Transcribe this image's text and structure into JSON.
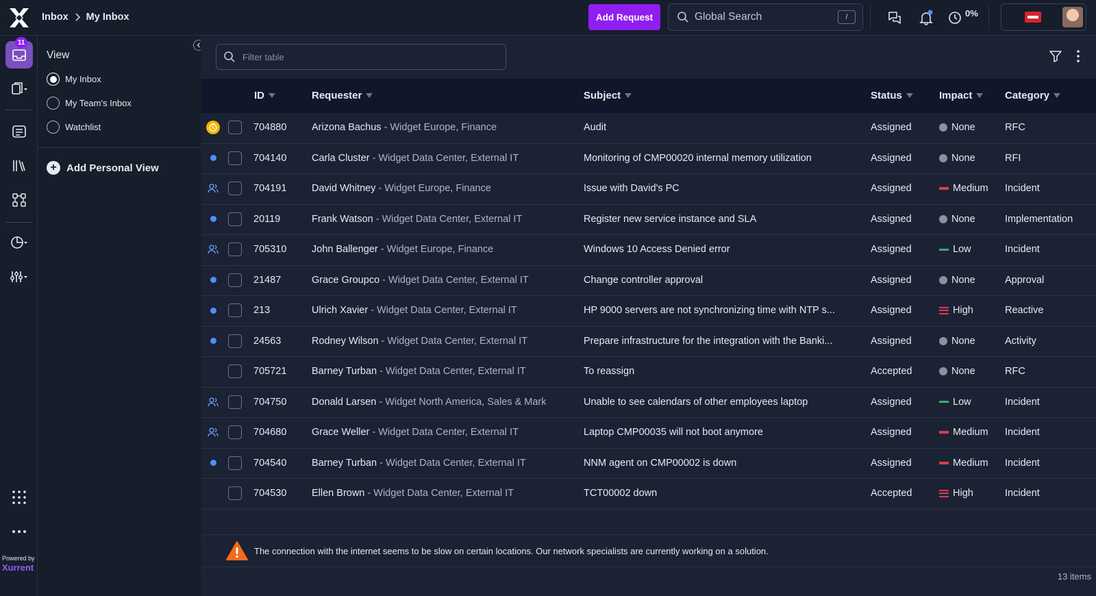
{
  "breadcrumb": {
    "root": "Inbox",
    "current": "My Inbox"
  },
  "topbar": {
    "add_request": "Add Request",
    "search_placeholder": "Global Search",
    "search_shortcut": "/",
    "percent": "0%"
  },
  "rail": {
    "inbox_badge": "11",
    "powered_by": "Powered by",
    "brand": "Xurrent"
  },
  "views": {
    "title": "View",
    "options": [
      {
        "label": "My Inbox",
        "selected": true
      },
      {
        "label": "My Team's Inbox",
        "selected": false
      },
      {
        "label": "Watchlist",
        "selected": false
      }
    ],
    "add_label": "Add Personal View"
  },
  "filter": {
    "placeholder": "Filter table"
  },
  "table": {
    "columns": {
      "id": "ID",
      "requester": "Requester",
      "subject": "Subject",
      "status": "Status",
      "impact": "Impact",
      "category": "Category"
    },
    "rows": [
      {
        "indicator": "clock",
        "id": "704880",
        "name": "Arizona Bachus",
        "org": " - Widget Europe, Finance",
        "subject": "Audit",
        "status": "Assigned",
        "impact": "None",
        "impact_level": "none",
        "category": "RFC"
      },
      {
        "indicator": "dot",
        "id": "704140",
        "name": "Carla Cluster",
        "org": " - Widget Data Center, External IT",
        "subject": "Monitoring of CMP00020 internal memory utilization",
        "status": "Assigned",
        "impact": "None",
        "impact_level": "none",
        "category": "RFI"
      },
      {
        "indicator": "team",
        "id": "704191",
        "name": "David Whitney",
        "org": " - Widget Europe, Finance",
        "subject": "Issue with David's PC",
        "status": "Assigned",
        "impact": "Medium",
        "impact_level": "medium",
        "category": "Incident"
      },
      {
        "indicator": "dot",
        "id": "20119",
        "name": "Frank Watson",
        "org": " - Widget Data Center, External IT",
        "subject": "Register new service instance and SLA",
        "status": "Assigned",
        "impact": "None",
        "impact_level": "none",
        "category": "Implementation"
      },
      {
        "indicator": "team",
        "id": "705310",
        "name": "John Ballenger",
        "org": " - Widget Europe, Finance",
        "subject": "Windows 10 Access Denied error",
        "status": "Assigned",
        "impact": "Low",
        "impact_level": "low",
        "category": "Incident"
      },
      {
        "indicator": "dot",
        "id": "21487",
        "name": "Grace Groupco",
        "org": " - Widget Data Center, External IT",
        "subject": "Change controller approval",
        "status": "Assigned",
        "impact": "None",
        "impact_level": "none",
        "category": "Approval"
      },
      {
        "indicator": "dot",
        "id": "213",
        "name": "Ulrich Xavier",
        "org": " - Widget Data Center, External IT",
        "subject": "HP 9000 servers are not synchronizing time with NTP s...",
        "status": "Assigned",
        "impact": "High",
        "impact_level": "high",
        "category": "Reactive"
      },
      {
        "indicator": "dot",
        "id": "24563",
        "name": "Rodney Wilson",
        "org": " - Widget Data Center, External IT",
        "subject": "Prepare infrastructure for the integration with the Banki...",
        "status": "Assigned",
        "impact": "None",
        "impact_level": "none",
        "category": "Activity"
      },
      {
        "indicator": "",
        "id": "705721",
        "name": "Barney Turban",
        "org": " - Widget Data Center, External IT",
        "subject": "To reassign",
        "status": "Accepted",
        "impact": "None",
        "impact_level": "none",
        "category": "RFC"
      },
      {
        "indicator": "team",
        "id": "704750",
        "name": "Donald Larsen",
        "org": " - Widget North America, Sales & Mark",
        "subject": "Unable to see calendars of other employees laptop",
        "status": "Assigned",
        "impact": "Low",
        "impact_level": "low",
        "category": "Incident"
      },
      {
        "indicator": "team",
        "id": "704680",
        "name": "Grace Weller",
        "org": " - Widget Data Center, External IT",
        "subject": "Laptop CMP00035 will not boot anymore",
        "status": "Assigned",
        "impact": "Medium",
        "impact_level": "medium",
        "category": "Incident"
      },
      {
        "indicator": "dot",
        "id": "704540",
        "name": "Barney Turban",
        "org": " - Widget Data Center, External IT",
        "subject": "NNM agent on CMP00002 is down",
        "status": "Assigned",
        "impact": "Medium",
        "impact_level": "medium",
        "category": "Incident"
      },
      {
        "indicator": "",
        "id": "704530",
        "name": "Ellen Brown",
        "org": " - Widget Data Center, External IT",
        "subject": "TCT00002 down",
        "status": "Accepted",
        "impact": "High",
        "impact_level": "high",
        "category": "Incident"
      }
    ]
  },
  "banner": {
    "message": "The connection with the internet seems to be slow on certain locations. Our network specialists are currently working on a solution."
  },
  "footer": {
    "items_count": "13 items"
  },
  "colors": {
    "accent": "#8f1ef0",
    "unread_dot": "#4f8ff7",
    "impact_high": "#e0394e",
    "impact_low": "#2fb36b",
    "warning": "#f26b1d"
  }
}
